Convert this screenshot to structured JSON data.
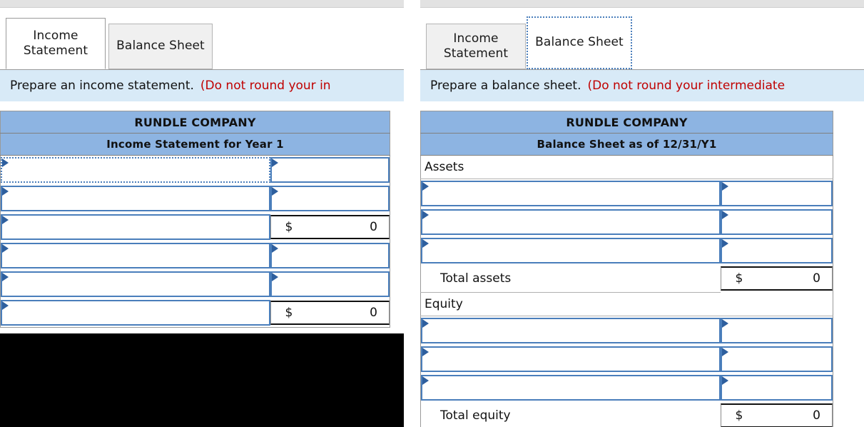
{
  "left_panel": {
    "tabs": [
      {
        "label": "Income Statement",
        "state": "active"
      },
      {
        "label": "Balance Sheet",
        "state": "inactive"
      }
    ],
    "instruction": {
      "main": "Prepare an income statement.",
      "note": "(Do not round your in"
    },
    "sheet": {
      "company": "RUNDLE COMPANY",
      "title": "Income Statement for Year 1",
      "rows": [
        {
          "type": "input",
          "selected": true,
          "label": "",
          "value": ""
        },
        {
          "type": "input",
          "selected": false,
          "label": "",
          "value": ""
        },
        {
          "type": "input_money",
          "label": "",
          "currency": "$",
          "amount": "0"
        },
        {
          "type": "input",
          "selected": false,
          "label": "",
          "value": ""
        },
        {
          "type": "input",
          "selected": false,
          "label": "",
          "value": ""
        },
        {
          "type": "input_money",
          "label": "",
          "currency": "$",
          "amount": "0"
        }
      ]
    }
  },
  "right_panel": {
    "tabs": [
      {
        "label": "Income Statement",
        "state": "inactive"
      },
      {
        "label": "Balance Sheet",
        "state": "active-focused"
      }
    ],
    "instruction": {
      "main": "Prepare a balance sheet.",
      "note": "(Do not round your intermediate"
    },
    "sheet": {
      "company": "RUNDLE COMPANY",
      "title": "Balance Sheet as of 12/31/Y1",
      "rows": [
        {
          "type": "section",
          "label": "Assets"
        },
        {
          "type": "input",
          "label": "",
          "value": ""
        },
        {
          "type": "input",
          "label": "",
          "value": ""
        },
        {
          "type": "input",
          "label": "",
          "value": ""
        },
        {
          "type": "total",
          "label": "Total assets",
          "currency": "$",
          "amount": "0"
        },
        {
          "type": "section",
          "label": "Equity"
        },
        {
          "type": "input",
          "label": "",
          "value": ""
        },
        {
          "type": "input",
          "label": "",
          "value": ""
        },
        {
          "type": "input",
          "label": "",
          "value": ""
        },
        {
          "type": "total",
          "label": "Total equity",
          "currency": "$",
          "amount": "0"
        }
      ]
    }
  },
  "colors": {
    "header_blue": "#8db4e2",
    "instruction_blue": "#d8eaf7",
    "input_border_blue": "#4a7ebb",
    "triangle_blue": "#2e5f9e",
    "note_red": "#c00000",
    "tab_inactive_gray": "#f0f0f0",
    "top_strip_gray": "#e2e2e2"
  }
}
